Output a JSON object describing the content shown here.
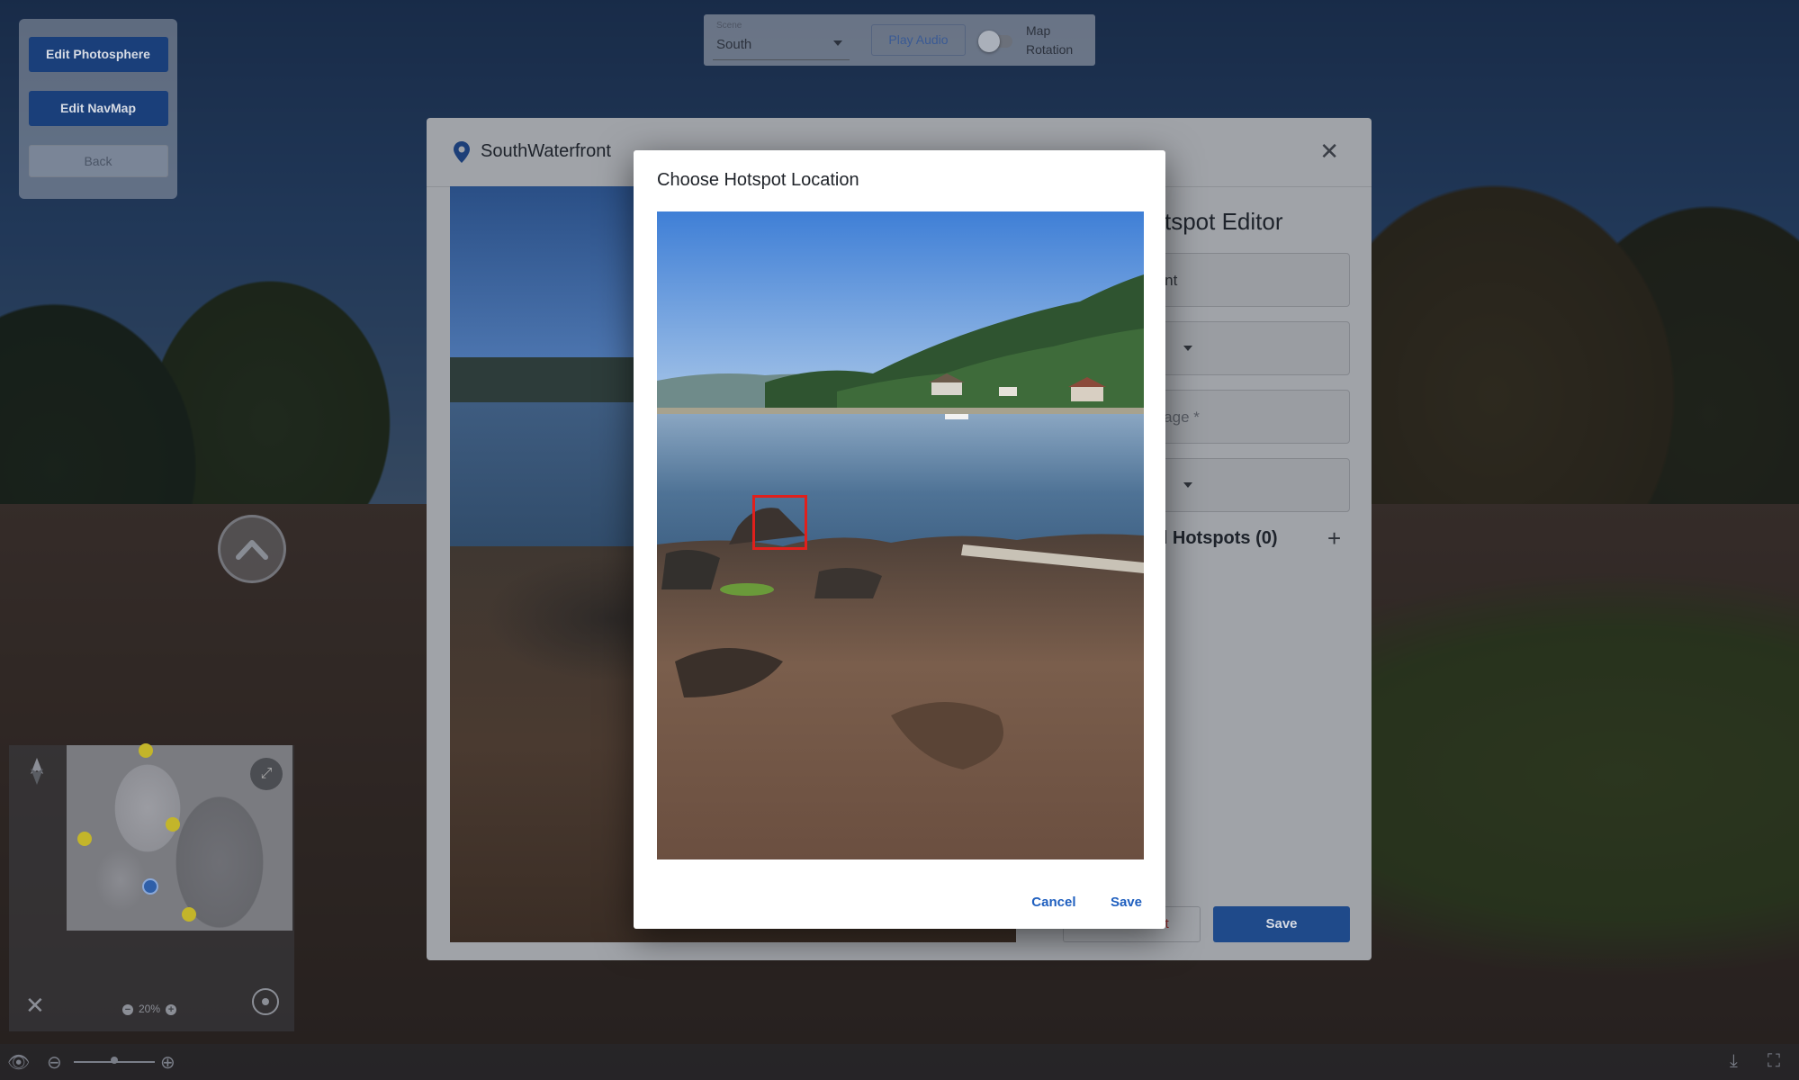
{
  "edit_panel": {
    "edit_photosphere": "Edit Photosphere",
    "edit_navmap": "Edit NavMap",
    "back": "Back"
  },
  "toolbar": {
    "scene_label": "Scene",
    "scene_value": "South",
    "play_audio": "Play Audio",
    "map_rotation_label": "Map Rotation",
    "map_rotation_enabled": false
  },
  "minimap": {
    "zoom_level": "20%",
    "zoom_out_symbol": "−",
    "zoom_in_symbol": "+"
  },
  "underlying_dialog": {
    "title": "SouthWaterfront",
    "editor_title_visible": "tspot Editor",
    "field_1_value": "ront",
    "field_3_label_visible": "mage *",
    "hotspots_label_visible": "ed Hotspots (0)",
    "delete_button_visible": "ot",
    "save_button": "Save"
  },
  "modal": {
    "title": "Choose Hotspot Location",
    "cancel": "Cancel",
    "save": "Save"
  },
  "colors": {
    "primary_blue": "#1f5fbf",
    "dark_blue_button": "#1a3f7a",
    "marker_red": "#e0201c"
  },
  "icons": {
    "pin": "location-pin-icon",
    "close": "close-icon",
    "plus": "plus-icon",
    "compass": "north-arrow-icon",
    "expand": "expand-map-icon",
    "locate": "locate-icon",
    "nav_up": "chevron-up-circle-icon"
  }
}
